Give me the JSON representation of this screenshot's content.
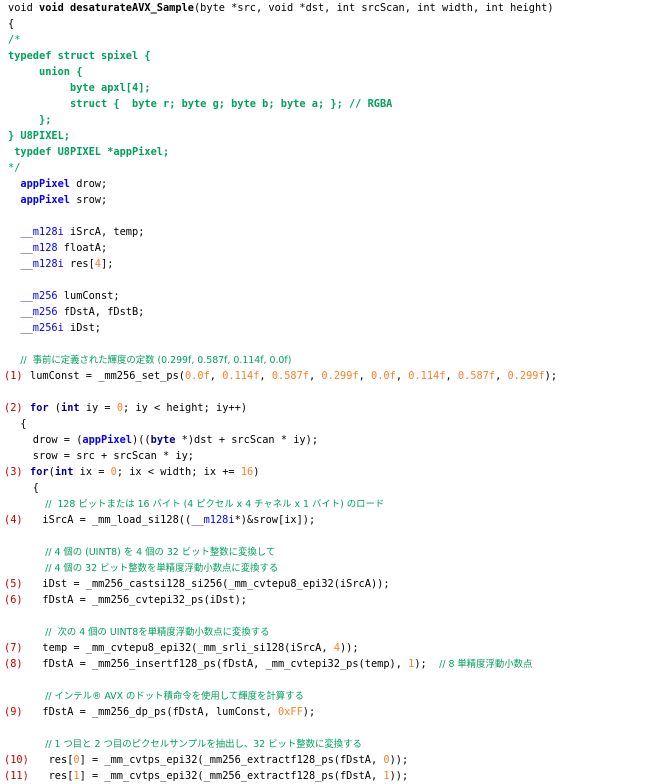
{
  "code_lines": [
    {
      "ln": "",
      "indent": 0,
      "segs": [
        [
          "plain",
          "void "
        ],
        [
          "bold",
          "void desaturateAVX_Sample"
        ],
        [
          "plain",
          "(byte *src, void *dst, int srcScan, int width, int height)"
        ]
      ]
    },
    {
      "ln": "",
      "indent": 0,
      "segs": [
        [
          "plain",
          "{"
        ]
      ]
    },
    {
      "ln": "",
      "indent": 0,
      "segs": [
        [
          "green",
          "/*"
        ]
      ]
    },
    {
      "ln": "",
      "indent": 0,
      "segs": [
        [
          "greenb",
          "typedef struct spixel {"
        ]
      ]
    },
    {
      "ln": "",
      "indent": 5,
      "segs": [
        [
          "greenb",
          "union {"
        ]
      ]
    },
    {
      "ln": "",
      "indent": 10,
      "segs": [
        [
          "greenb",
          "byte apxl[4];"
        ]
      ]
    },
    {
      "ln": "",
      "indent": 10,
      "segs": [
        [
          "greenb",
          "struct {  byte r; byte g; byte b; byte a; }; // RGBA"
        ]
      ]
    },
    {
      "ln": "",
      "indent": 5,
      "segs": [
        [
          "greenb",
          "};"
        ]
      ]
    },
    {
      "ln": "",
      "indent": 0,
      "segs": [
        [
          "greenb",
          "} U8PIXEL;"
        ]
      ]
    },
    {
      "ln": "",
      "indent": 0,
      "segs": [
        [
          "greenb",
          " typdef U8PIXEL *appPixel;"
        ]
      ]
    },
    {
      "ln": "",
      "indent": 0,
      "segs": [
        [
          "green",
          "*/"
        ]
      ]
    },
    {
      "ln": "",
      "indent": 2,
      "segs": [
        [
          "blueb",
          "appPixel"
        ],
        [
          "plain",
          " drow;"
        ]
      ]
    },
    {
      "ln": "",
      "indent": 2,
      "segs": [
        [
          "blueb",
          "appPixel"
        ],
        [
          "plain",
          " srow;"
        ]
      ]
    },
    {
      "ln": "",
      "indent": 0,
      "segs": []
    },
    {
      "ln": "",
      "indent": 2,
      "segs": [
        [
          "blue",
          "__m128i"
        ],
        [
          "plain",
          " iSrcA, temp;"
        ]
      ]
    },
    {
      "ln": "",
      "indent": 2,
      "segs": [
        [
          "blue",
          "__m128"
        ],
        [
          "plain",
          " floatA;"
        ]
      ]
    },
    {
      "ln": "",
      "indent": 2,
      "segs": [
        [
          "blue",
          "__m128i"
        ],
        [
          "plain",
          " res["
        ],
        [
          "orange",
          "4"
        ],
        [
          "plain",
          "];"
        ]
      ]
    },
    {
      "ln": "",
      "indent": 0,
      "segs": []
    },
    {
      "ln": "",
      "indent": 2,
      "segs": [
        [
          "blue",
          "__m256"
        ],
        [
          "plain",
          " lumConst;"
        ]
      ]
    },
    {
      "ln": "",
      "indent": 2,
      "segs": [
        [
          "blue",
          "__m256"
        ],
        [
          "plain",
          " fDstA, fDstB;"
        ]
      ]
    },
    {
      "ln": "",
      "indent": 2,
      "segs": [
        [
          "blue",
          "__m256i"
        ],
        [
          "plain",
          " iDst;"
        ]
      ]
    },
    {
      "ln": "",
      "indent": 0,
      "segs": []
    },
    {
      "ln": "",
      "indent": 2,
      "segs": [
        [
          "greenjp",
          "//  事前に定義された輝度の定数 (0.299f, 0.587f, 0.114f, 0.0f)"
        ]
      ]
    },
    {
      "ln": "(1)",
      "indent": 0,
      "segs": [
        [
          "plain",
          "lumConst = _mm256_set_ps("
        ],
        [
          "orange",
          "0.0f"
        ],
        [
          "plain",
          ", "
        ],
        [
          "orange",
          "0.114f"
        ],
        [
          "plain",
          ", "
        ],
        [
          "orange",
          "0.587f"
        ],
        [
          "plain",
          ", "
        ],
        [
          "orange",
          "0.299f"
        ],
        [
          "plain",
          ", "
        ],
        [
          "orange",
          "0.0f"
        ],
        [
          "plain",
          ", "
        ],
        [
          "orange",
          "0.114f"
        ],
        [
          "plain",
          ", "
        ],
        [
          "orange",
          "0.587f"
        ],
        [
          "plain",
          ", "
        ],
        [
          "orange",
          "0.299f"
        ],
        [
          "plain",
          ");"
        ]
      ]
    },
    {
      "ln": "",
      "indent": 0,
      "segs": []
    },
    {
      "ln": "(2)",
      "indent": 0,
      "segs": [
        [
          "kw",
          "for"
        ],
        [
          "plain",
          " ("
        ],
        [
          "kw",
          "int"
        ],
        [
          "plain",
          " iy = "
        ],
        [
          "orange",
          "0"
        ],
        [
          "plain",
          "; iy < height; iy++)"
        ]
      ]
    },
    {
      "ln": "",
      "indent": 2,
      "segs": [
        [
          "plain",
          "{"
        ]
      ]
    },
    {
      "ln": "",
      "indent": 4,
      "segs": [
        [
          "plain",
          "drow = ("
        ],
        [
          "blueb",
          "appPixel"
        ],
        [
          "plain",
          ")(("
        ],
        [
          "kw",
          "byte"
        ],
        [
          "plain",
          " *)dst + srcScan * iy);"
        ]
      ]
    },
    {
      "ln": "",
      "indent": 4,
      "segs": [
        [
          "plain",
          "srow = src + srcScan * iy;"
        ]
      ]
    },
    {
      "ln": "(3)",
      "indent": 0,
      "segs": [
        [
          "kw",
          "for"
        ],
        [
          "plain",
          "("
        ],
        [
          "kw",
          "int"
        ],
        [
          "plain",
          " ix = "
        ],
        [
          "orange",
          "0"
        ],
        [
          "plain",
          "; ix < width; ix += "
        ],
        [
          "orange",
          "16"
        ],
        [
          "plain",
          ")"
        ]
      ]
    },
    {
      "ln": "",
      "indent": 4,
      "segs": [
        [
          "plain",
          "{"
        ]
      ]
    },
    {
      "ln": "",
      "indent": 6,
      "segs": [
        [
          "greenjp",
          "//  128 ビットまたは 16 バイト (4 ピクセル x 4 チャネル x 1 バイト) のロード"
        ]
      ]
    },
    {
      "ln": "(4)",
      "indent": 2,
      "segs": [
        [
          "plain",
          "iSrcA = _mm_load_si128(("
        ],
        [
          "blue",
          "__m128i"
        ],
        [
          "plain",
          "*)&srow[ix]);"
        ]
      ]
    },
    {
      "ln": "",
      "indent": 0,
      "segs": []
    },
    {
      "ln": "",
      "indent": 6,
      "segs": [
        [
          "greenjp",
          "// 4 個の (UINT8) を 4 個の 32 ビット整数に変換して"
        ]
      ]
    },
    {
      "ln": "",
      "indent": 6,
      "segs": [
        [
          "greenjp",
          "// 4 個の 32 ビット整数を単精度浮動小数点に変換する"
        ]
      ]
    },
    {
      "ln": "(5)",
      "indent": 2,
      "segs": [
        [
          "plain",
          "iDst = _mm256_castsi128_si256(_mm_cvtepu8_epi32(iSrcA));"
        ]
      ]
    },
    {
      "ln": "(6)",
      "indent": 2,
      "segs": [
        [
          "plain",
          "fDstA = _mm256_cvtepi32_ps(iDst);"
        ]
      ]
    },
    {
      "ln": "",
      "indent": 0,
      "segs": []
    },
    {
      "ln": "",
      "indent": 6,
      "segs": [
        [
          "greenjp",
          "//  次の 4 個の UINT8を単精度浮動小数点に変換する"
        ]
      ]
    },
    {
      "ln": "(7)",
      "indent": 2,
      "segs": [
        [
          "plain",
          "temp = _mm_cvtepu8_epi32(_mm_srli_si128(iSrcA, "
        ],
        [
          "orange",
          "4"
        ],
        [
          "plain",
          "));"
        ]
      ]
    },
    {
      "ln": "(8)",
      "indent": 2,
      "segs": [
        [
          "plain",
          "fDstA = _mm256_insertf128_ps(fDstA, _mm_cvtepi32_ps(temp), "
        ],
        [
          "orange",
          "1"
        ],
        [
          "plain",
          ");  "
        ],
        [
          "greenjp",
          "// 8 単精度浮動小数点"
        ]
      ]
    },
    {
      "ln": "",
      "indent": 0,
      "segs": []
    },
    {
      "ln": "",
      "indent": 6,
      "segs": [
        [
          "greenjp",
          "// インテル® AVX のドット積命令を使用して輝度を計算する"
        ]
      ]
    },
    {
      "ln": "(9)",
      "indent": 2,
      "segs": [
        [
          "plain",
          "fDstA = _mm256_dp_ps(fDstA, lumConst, "
        ],
        [
          "orange",
          "0xFF"
        ],
        [
          "plain",
          ");"
        ]
      ]
    },
    {
      "ln": "",
      "indent": 0,
      "segs": []
    },
    {
      "ln": "",
      "indent": 6,
      "segs": [
        [
          "greenjp",
          "// 1 つ目と 2 つ目のピクセルサンプルを抽出し、32 ビット整数に変換する"
        ]
      ]
    },
    {
      "ln": "(10)",
      "indent": 3,
      "segs": [
        [
          "plain",
          "res["
        ],
        [
          "orange",
          "0"
        ],
        [
          "plain",
          "] = _mm_cvtps_epi32(_mm256_extractf128_ps(fDstA, "
        ],
        [
          "orange",
          "0"
        ],
        [
          "plain",
          "));"
        ]
      ]
    },
    {
      "ln": "(11)",
      "indent": 3,
      "segs": [
        [
          "plain",
          "res["
        ],
        [
          "orange",
          "1"
        ],
        [
          "plain",
          "] = _mm_cvtps_epi32(_mm256_extractf128_ps(fDstA, "
        ],
        [
          "orange",
          "1"
        ],
        [
          "plain",
          "));"
        ]
      ]
    }
  ]
}
